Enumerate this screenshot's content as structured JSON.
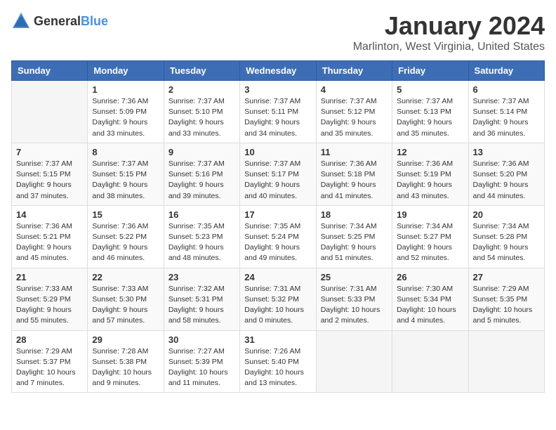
{
  "header": {
    "logo_general": "General",
    "logo_blue": "Blue",
    "month": "January 2024",
    "location": "Marlinton, West Virginia, United States"
  },
  "days_of_week": [
    "Sunday",
    "Monday",
    "Tuesday",
    "Wednesday",
    "Thursday",
    "Friday",
    "Saturday"
  ],
  "weeks": [
    [
      {
        "day": "",
        "info": ""
      },
      {
        "day": "1",
        "info": "Sunrise: 7:36 AM\nSunset: 5:09 PM\nDaylight: 9 hours\nand 33 minutes."
      },
      {
        "day": "2",
        "info": "Sunrise: 7:37 AM\nSunset: 5:10 PM\nDaylight: 9 hours\nand 33 minutes."
      },
      {
        "day": "3",
        "info": "Sunrise: 7:37 AM\nSunset: 5:11 PM\nDaylight: 9 hours\nand 34 minutes."
      },
      {
        "day": "4",
        "info": "Sunrise: 7:37 AM\nSunset: 5:12 PM\nDaylight: 9 hours\nand 35 minutes."
      },
      {
        "day": "5",
        "info": "Sunrise: 7:37 AM\nSunset: 5:13 PM\nDaylight: 9 hours\nand 35 minutes."
      },
      {
        "day": "6",
        "info": "Sunrise: 7:37 AM\nSunset: 5:14 PM\nDaylight: 9 hours\nand 36 minutes."
      }
    ],
    [
      {
        "day": "7",
        "info": "Sunrise: 7:37 AM\nSunset: 5:15 PM\nDaylight: 9 hours\nand 37 minutes."
      },
      {
        "day": "8",
        "info": "Sunrise: 7:37 AM\nSunset: 5:15 PM\nDaylight: 9 hours\nand 38 minutes."
      },
      {
        "day": "9",
        "info": "Sunrise: 7:37 AM\nSunset: 5:16 PM\nDaylight: 9 hours\nand 39 minutes."
      },
      {
        "day": "10",
        "info": "Sunrise: 7:37 AM\nSunset: 5:17 PM\nDaylight: 9 hours\nand 40 minutes."
      },
      {
        "day": "11",
        "info": "Sunrise: 7:36 AM\nSunset: 5:18 PM\nDaylight: 9 hours\nand 41 minutes."
      },
      {
        "day": "12",
        "info": "Sunrise: 7:36 AM\nSunset: 5:19 PM\nDaylight: 9 hours\nand 43 minutes."
      },
      {
        "day": "13",
        "info": "Sunrise: 7:36 AM\nSunset: 5:20 PM\nDaylight: 9 hours\nand 44 minutes."
      }
    ],
    [
      {
        "day": "14",
        "info": "Sunrise: 7:36 AM\nSunset: 5:21 PM\nDaylight: 9 hours\nand 45 minutes."
      },
      {
        "day": "15",
        "info": "Sunrise: 7:36 AM\nSunset: 5:22 PM\nDaylight: 9 hours\nand 46 minutes."
      },
      {
        "day": "16",
        "info": "Sunrise: 7:35 AM\nSunset: 5:23 PM\nDaylight: 9 hours\nand 48 minutes."
      },
      {
        "day": "17",
        "info": "Sunrise: 7:35 AM\nSunset: 5:24 PM\nDaylight: 9 hours\nand 49 minutes."
      },
      {
        "day": "18",
        "info": "Sunrise: 7:34 AM\nSunset: 5:25 PM\nDaylight: 9 hours\nand 51 minutes."
      },
      {
        "day": "19",
        "info": "Sunrise: 7:34 AM\nSunset: 5:27 PM\nDaylight: 9 hours\nand 52 minutes."
      },
      {
        "day": "20",
        "info": "Sunrise: 7:34 AM\nSunset: 5:28 PM\nDaylight: 9 hours\nand 54 minutes."
      }
    ],
    [
      {
        "day": "21",
        "info": "Sunrise: 7:33 AM\nSunset: 5:29 PM\nDaylight: 9 hours\nand 55 minutes."
      },
      {
        "day": "22",
        "info": "Sunrise: 7:33 AM\nSunset: 5:30 PM\nDaylight: 9 hours\nand 57 minutes."
      },
      {
        "day": "23",
        "info": "Sunrise: 7:32 AM\nSunset: 5:31 PM\nDaylight: 9 hours\nand 58 minutes."
      },
      {
        "day": "24",
        "info": "Sunrise: 7:31 AM\nSunset: 5:32 PM\nDaylight: 10 hours\nand 0 minutes."
      },
      {
        "day": "25",
        "info": "Sunrise: 7:31 AM\nSunset: 5:33 PM\nDaylight: 10 hours\nand 2 minutes."
      },
      {
        "day": "26",
        "info": "Sunrise: 7:30 AM\nSunset: 5:34 PM\nDaylight: 10 hours\nand 4 minutes."
      },
      {
        "day": "27",
        "info": "Sunrise: 7:29 AM\nSunset: 5:35 PM\nDaylight: 10 hours\nand 5 minutes."
      }
    ],
    [
      {
        "day": "28",
        "info": "Sunrise: 7:29 AM\nSunset: 5:37 PM\nDaylight: 10 hours\nand 7 minutes."
      },
      {
        "day": "29",
        "info": "Sunrise: 7:28 AM\nSunset: 5:38 PM\nDaylight: 10 hours\nand 9 minutes."
      },
      {
        "day": "30",
        "info": "Sunrise: 7:27 AM\nSunset: 5:39 PM\nDaylight: 10 hours\nand 11 minutes."
      },
      {
        "day": "31",
        "info": "Sunrise: 7:26 AM\nSunset: 5:40 PM\nDaylight: 10 hours\nand 13 minutes."
      },
      {
        "day": "",
        "info": ""
      },
      {
        "day": "",
        "info": ""
      },
      {
        "day": "",
        "info": ""
      }
    ]
  ]
}
